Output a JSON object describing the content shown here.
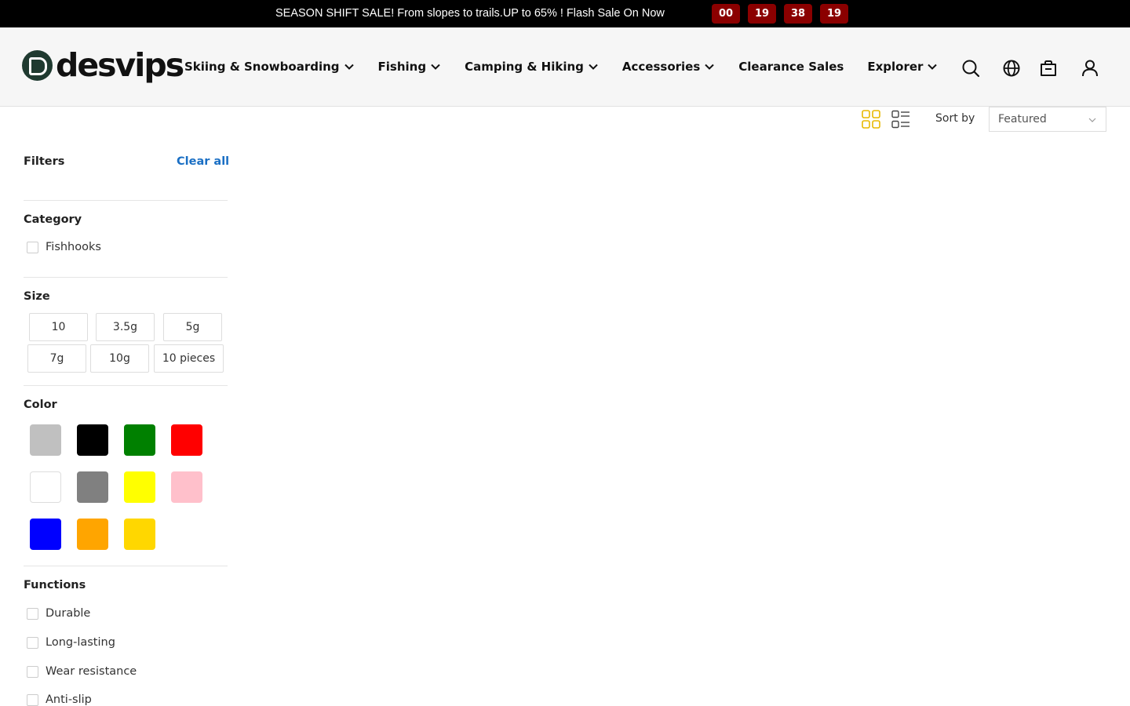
{
  "announcement": {
    "text": "SEASON SHIFT SALE! From slopes to trails.UP to 65% ! Flash Sale On Now",
    "countdown": [
      "00",
      "19",
      "38",
      "19"
    ],
    "bg_color": "#000000",
    "countdown_color": "#8b0000"
  },
  "header": {
    "logo_text": "desvips",
    "nav": [
      {
        "label": "Skiing & Snowboarding",
        "has_dropdown": true
      },
      {
        "label": "Fishing",
        "has_dropdown": true
      },
      {
        "label": "Camping & Hiking",
        "has_dropdown": true
      },
      {
        "label": "Accessories",
        "has_dropdown": true
      },
      {
        "label": "Clearance Sales",
        "has_dropdown": false
      },
      {
        "label": "Explorer",
        "has_dropdown": true
      }
    ],
    "icons": [
      "search-icon",
      "globe-icon",
      "cart-icon",
      "account-icon"
    ]
  },
  "toolbar": {
    "view_modes": [
      "grid-view-icon",
      "list-view-icon"
    ],
    "active_view": "grid",
    "sort_label": "Sort by",
    "sort_value": "Featured",
    "accent_color": "#e8b800"
  },
  "filters": {
    "title": "Filters",
    "clear_label": "Clear all",
    "category": {
      "title": "Category",
      "options": [
        "Fishhooks"
      ]
    },
    "size": {
      "title": "Size",
      "options": [
        "10",
        "3.5g",
        "5g",
        "7g",
        "10g",
        "10 pieces"
      ]
    },
    "color": {
      "title": "Color",
      "swatches": [
        "#c0c0c0",
        "#000000",
        "#008000",
        "#ff0000",
        "#ffffff",
        "#808080",
        "#ffff00",
        "#ffc0cb",
        "#0000ff",
        "#ffa500",
        "#ffd700"
      ]
    },
    "functions": {
      "title": "Functions",
      "options": [
        "Durable",
        "Long-lasting",
        "Wear resistance",
        "Anti-slip"
      ]
    },
    "link_color": "#1a6fc4"
  }
}
